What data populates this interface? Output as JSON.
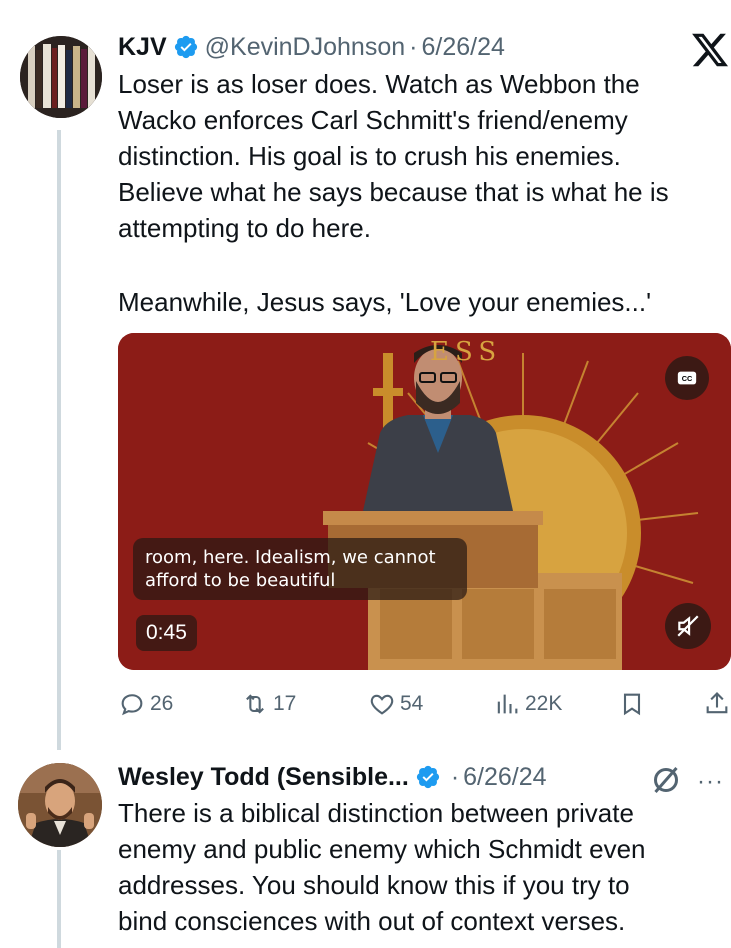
{
  "tweet1": {
    "display_name": "KJV",
    "handle": "@KevinDJohnson",
    "separator": "·",
    "date": "6/26/24",
    "text_lines": [
      "Loser is as loser does. Watch as Webbon the",
      "Wacko enforces Carl Schmitt's friend/enemy",
      "distinction. His goal is to crush his enemies.",
      "Believe what he says because that is what he is",
      "attempting to do here."
    ],
    "text_second_paragraph": "Meanwhile, Jesus says, 'Love your enemies...'",
    "video": {
      "backdrop_text": "ESS",
      "caption_line1": "room, here. Idealism, we cannot",
      "caption_line2": "afford to be beautiful",
      "timestamp": "0:45",
      "cc_label": "CC"
    },
    "actions": {
      "replies": "26",
      "retweets": "17",
      "likes": "54",
      "views": "22K"
    }
  },
  "tweet2": {
    "display_name": "Wesley Todd (Sensible...",
    "separator": "·",
    "date": "6/26/24",
    "more": "···",
    "text_lines": [
      "There is a biblical distinction between private",
      "enemy and public enemy which Schmidt even",
      "addresses. You should know this if you try to",
      "bind consciences with out of context verses."
    ]
  },
  "colors": {
    "text": "#0f1419",
    "secondary": "#536471",
    "verified_blue": "#1d9bf0",
    "thread_line": "#cfd9de",
    "video_bg": "#8c1c17"
  },
  "icons": [
    "x-logo-icon",
    "verified-icon",
    "reply-icon",
    "retweet-icon",
    "like-icon",
    "views-icon",
    "bookmark-icon",
    "share-icon",
    "cc-icon",
    "mute-icon",
    "grok-icon",
    "more-icon"
  ]
}
